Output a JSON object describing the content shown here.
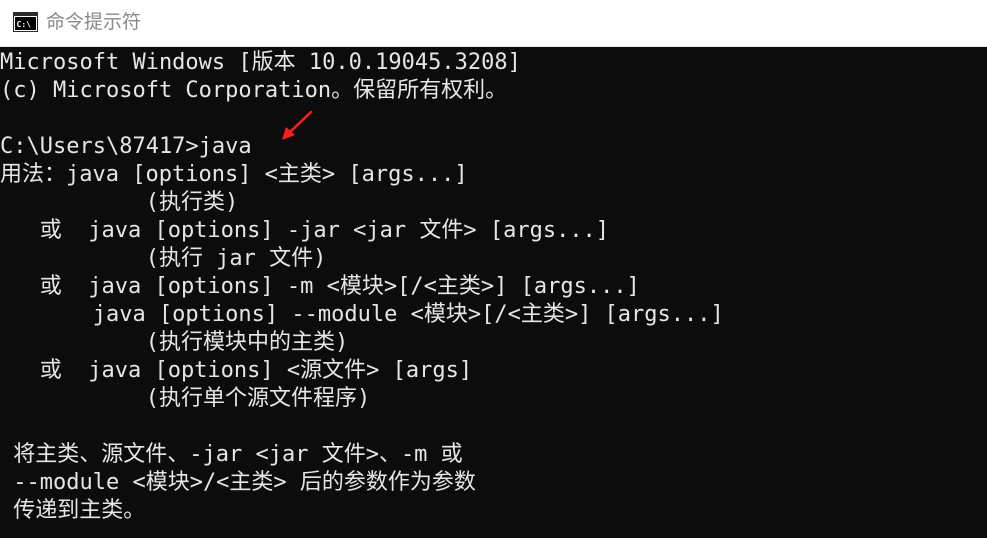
{
  "window": {
    "title": "命令提示符",
    "icon": "cmd-icon",
    "icon_label": "C:\\",
    "arrow_color": "#ff1e1e"
  },
  "console": {
    "lines": [
      "Microsoft Windows [版本 10.0.19045.3208]",
      "(c) Microsoft Corporation。保留所有权利。",
      "",
      "C:\\Users\\87417>java",
      "用法：java [options] <主类> [args...]",
      "           (执行类)",
      "   或  java [options] -jar <jar 文件> [args...]",
      "           (执行 jar 文件)",
      "   或  java [options] -m <模块>[/<主类>] [args...]",
      "       java [options] --module <模块>[/<主类>] [args...]",
      "           (执行模块中的主类)",
      "   或  java [options] <源文件> [args]",
      "           (执行单个源文件程序)",
      "",
      " 将主类、源文件、-jar <jar 文件>、-m 或",
      " --module <模块>/<主类> 后的参数作为参数",
      " 传递到主类。"
    ]
  }
}
